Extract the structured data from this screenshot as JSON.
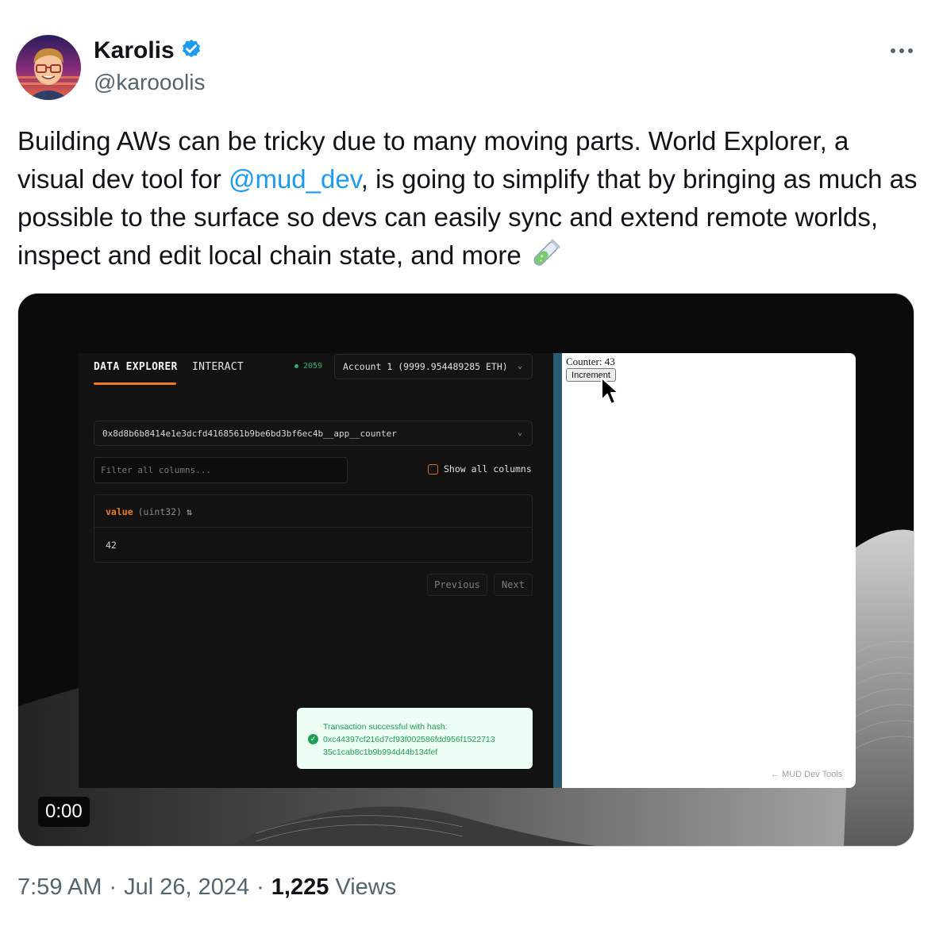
{
  "author": {
    "name": "Karolis",
    "handle": "@karooolis",
    "verified": true
  },
  "tweet": {
    "text_before": "Building AWs can be tricky due to many moving parts. World Explorer, a visual dev tool for ",
    "mention": "@mud_dev",
    "text_after": ", is going to simplify that by bringing as much as possible to the surface so devs can easily sync and extend remote worlds, inspect and edit local chain state, and more ",
    "emoji": "test-tube-icon"
  },
  "media": {
    "video_timer": "0:00",
    "devtools": {
      "tabs": [
        "DATA EXPLORER",
        "INTERACT"
      ],
      "block_number": "2059",
      "account": "Account 1 (9999.954489285 ETH)",
      "table": "0x8d8b6b8414e1e3dcfd4168561b9be6bd3bf6ec4b__app__counter",
      "filter_placeholder": "Filter all columns...",
      "show_all_columns": "Show all columns",
      "column_name": "value",
      "column_type": "(uint32)",
      "sort_icon": "⇅",
      "cell_value": "42",
      "prev_label": "Previous",
      "next_label": "Next",
      "toast_line1": "Transaction successful with hash:",
      "toast_line2": "0xc44397cf216d7cf93f002586fdd956f1522713",
      "toast_line3": "35c1cab8c1b9b994d44b134fef"
    },
    "app": {
      "counter": "Counter: 43",
      "increment": "Increment",
      "mud_link": "← MUD Dev Tools"
    }
  },
  "footer": {
    "time": "7:59 AM",
    "sep1": "·",
    "date": "Jul 26, 2024",
    "sep2": "·",
    "views_count": "1,225",
    "views_label": "Views"
  },
  "colors": {
    "link": "#1d9bf0",
    "verified": "#1d9bf0",
    "accent_orange": "#f07b24",
    "success_green": "#1f9d55"
  }
}
